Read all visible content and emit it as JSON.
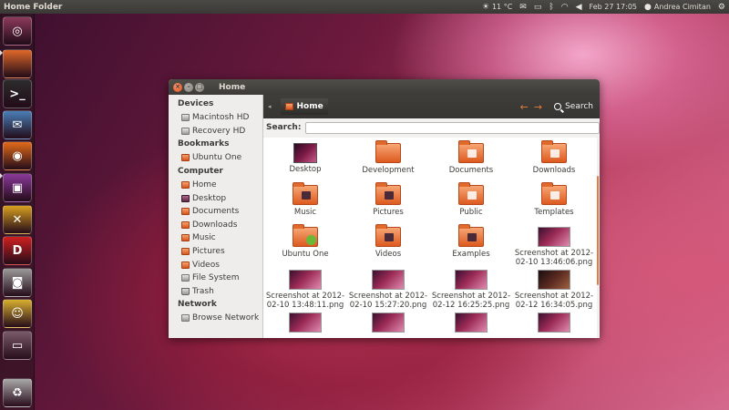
{
  "top_panel": {
    "app_title": "Home Folder",
    "weather": "11 °C",
    "datetime": "Feb 27 17:05",
    "user": "Andrea Cimitan"
  },
  "launcher": {
    "items": [
      {
        "name": "ubuntu-dash-icon",
        "glyph": "◎",
        "color": "#8d3a5c"
      },
      {
        "name": "home-folder-launcher-icon",
        "glyph": "",
        "color": "#e0682a"
      },
      {
        "name": "terminal-launcher-icon",
        "glyph": ">_",
        "color": "#2c2c2c"
      },
      {
        "name": "mail-client-launcher-icon",
        "glyph": "✉",
        "color": "#4a7fb8"
      },
      {
        "name": "firefox-launcher-icon",
        "glyph": "◉",
        "color": "#e36b1a"
      },
      {
        "name": "workspace-switcher-icon",
        "glyph": "▣",
        "color": "#8a3a9a"
      },
      {
        "name": "app-x-launcher-icon",
        "glyph": "✕",
        "color": "#d8a020"
      },
      {
        "name": "dictionary-launcher-icon",
        "glyph": "D",
        "color": "#d02020"
      },
      {
        "name": "screenshot-launcher-icon",
        "glyph": "◙",
        "color": "#9a9a9a"
      },
      {
        "name": "pidgin-launcher-icon",
        "glyph": "☺",
        "color": "#d8b030"
      },
      {
        "name": "window-launcher-icon",
        "glyph": "▭",
        "color": "#7a5a6a"
      },
      {
        "name": "trash-launcher-icon",
        "glyph": "♻",
        "color": "#aaaaaa"
      }
    ]
  },
  "window": {
    "title": "Home",
    "sidebar": {
      "devices_heading": "Devices",
      "devices": [
        "Macintosh HD",
        "Recovery HD"
      ],
      "bookmarks_heading": "Bookmarks",
      "bookmarks": [
        "Ubuntu One"
      ],
      "computer_heading": "Computer",
      "computer": [
        "Home",
        "Desktop",
        "Documents",
        "Downloads",
        "Music",
        "Pictures",
        "Videos",
        "File System",
        "Trash"
      ],
      "network_heading": "Network",
      "network": [
        "Browse Network"
      ]
    },
    "toolbar": {
      "crumb": "Home",
      "search_label": "Search"
    },
    "searchbar": {
      "label": "Search:",
      "value": ""
    },
    "files": [
      {
        "label": "Desktop",
        "kind": "desktop"
      },
      {
        "label": "Development",
        "kind": "folder"
      },
      {
        "label": "Documents",
        "kind": "folder-doc"
      },
      {
        "label": "Downloads",
        "kind": "folder-down"
      },
      {
        "label": "Music",
        "kind": "folder-music"
      },
      {
        "label": "Pictures",
        "kind": "folder-pic"
      },
      {
        "label": "Public",
        "kind": "folder-public"
      },
      {
        "label": "Templates",
        "kind": "folder-doc"
      },
      {
        "label": "Ubuntu One",
        "kind": "folder-ubuntu"
      },
      {
        "label": "Videos",
        "kind": "folder-video"
      },
      {
        "label": "Examples",
        "kind": "folder-link"
      },
      {
        "label": "Screenshot at 2012-02-10 13:46:06.png",
        "kind": "thumb"
      },
      {
        "label": "Screenshot at 2012-02-10 13:48:11.png",
        "kind": "thumb"
      },
      {
        "label": "Screenshot at 2012-02-10 15:27:20.png",
        "kind": "thumb"
      },
      {
        "label": "Screenshot at 2012-02-12 16:25:25.png",
        "kind": "thumb"
      },
      {
        "label": "Screenshot at 2012-02-12 16:34:05.png",
        "kind": "thumb-dark"
      },
      {
        "label": "",
        "kind": "thumb"
      },
      {
        "label": "",
        "kind": "thumb"
      },
      {
        "label": "",
        "kind": "thumb"
      },
      {
        "label": "",
        "kind": "thumb"
      }
    ]
  }
}
